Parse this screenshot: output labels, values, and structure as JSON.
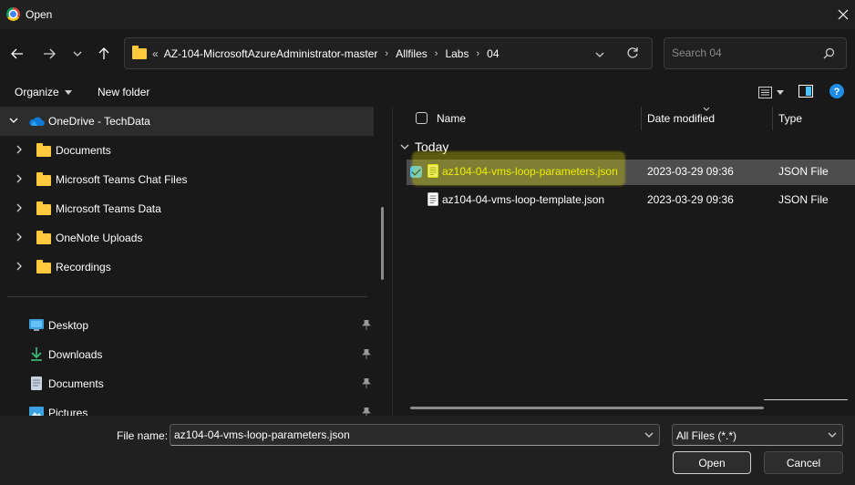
{
  "window": {
    "title": "Open"
  },
  "address": {
    "lead": "«",
    "crumbs": [
      "AZ-104-MicrosoftAzureAdministrator-master",
      "Allfiles",
      "Labs",
      "04"
    ]
  },
  "search": {
    "placeholder": "Search 04"
  },
  "toolbar": {
    "organize_label": "Organize",
    "new_folder_label": "New folder"
  },
  "nav": {
    "root": {
      "label": "OneDrive - TechData"
    },
    "folders": [
      {
        "label": "Documents"
      },
      {
        "label": "Microsoft Teams Chat Files"
      },
      {
        "label": "Microsoft Teams Data"
      },
      {
        "label": "OneNote Uploads"
      },
      {
        "label": "Recordings"
      }
    ],
    "quick_access": [
      {
        "label": "Desktop",
        "icon": "desktop-icon"
      },
      {
        "label": "Downloads",
        "icon": "download-icon"
      },
      {
        "label": "Documents",
        "icon": "documents-icon"
      },
      {
        "label": "Pictures",
        "icon": "pictures-icon"
      }
    ]
  },
  "columns": {
    "name": "Name",
    "date": "Date modified",
    "type": "Type"
  },
  "group": {
    "label": "Today"
  },
  "files": [
    {
      "name": "az104-04-vms-loop-parameters.json",
      "date": "2023-03-29 09:36",
      "type": "JSON File",
      "selected": true
    },
    {
      "name": "az104-04-vms-loop-template.json",
      "date": "2023-03-29 09:36",
      "type": "JSON File",
      "selected": false
    }
  ],
  "footer": {
    "file_name_label": "File name:",
    "file_name_value": "az104-04-vms-loop-parameters.json",
    "filter_value": "All Files (*.*)",
    "open_label": "Open",
    "cancel_label": "Cancel"
  },
  "colors": {
    "accent": "#4cc2ff",
    "folder": "#ffc83d",
    "highlight": "#e6e600"
  }
}
